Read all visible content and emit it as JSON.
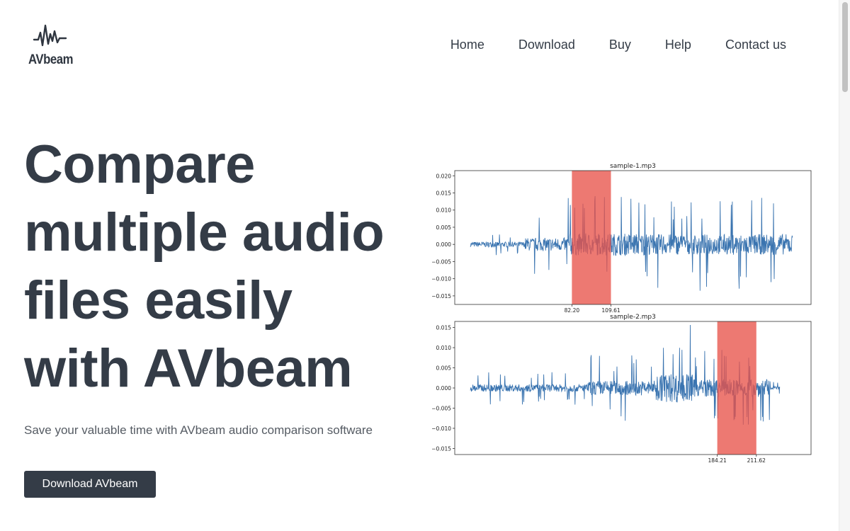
{
  "brand": {
    "name": "AVbeam",
    "logo_icon": "waveform-icon"
  },
  "nav": {
    "items": [
      {
        "label": "Home"
      },
      {
        "label": "Download"
      },
      {
        "label": "Buy"
      },
      {
        "label": "Help"
      },
      {
        "label": "Contact us"
      }
    ]
  },
  "hero": {
    "title_lines": [
      "Compare",
      "multiple audio",
      "files easily",
      "with AVbeam"
    ],
    "subtitle": "Save your valuable time with AVbeam audio comparison software",
    "cta_label": "Download AVbeam"
  },
  "colors": {
    "text_dark": "#343c47",
    "button_bg": "#343c47",
    "waveform": "#3a74b0",
    "highlight": "#e8534a"
  },
  "chart_data": [
    {
      "type": "line",
      "title": "sample-1.mp3",
      "ylim": [
        -0.0175,
        0.0215
      ],
      "yticks": [
        0.02,
        0.015,
        0.01,
        0.005,
        0.0,
        -0.005,
        -0.01,
        -0.015
      ],
      "ytick_labels": [
        "0.020",
        "0.015",
        "0.010",
        "0.005",
        "0.000",
        "−0.005",
        "−0.010",
        "−0.015"
      ],
      "xlim": [
        0,
        250
      ],
      "highlight": {
        "start": 82.2,
        "end": 109.61
      },
      "xtick_labels": [
        "82.20",
        "109.61"
      ],
      "signal_span": [
        11,
        237
      ],
      "grid": false
    },
    {
      "type": "line",
      "title": "sample-2.mp3",
      "ylim": [
        -0.0165,
        0.0165
      ],
      "yticks": [
        0.015,
        0.01,
        0.005,
        0.0,
        -0.005,
        -0.01,
        -0.015
      ],
      "ytick_labels": [
        "0.015",
        "0.010",
        "0.005",
        "0.000",
        "−0.005",
        "−0.010",
        "−0.015"
      ],
      "xlim": [
        0,
        250
      ],
      "highlight": {
        "start": 184.21,
        "end": 211.62
      },
      "xtick_labels": [
        "184.21",
        "211.62"
      ],
      "signal_span": [
        11,
        228
      ],
      "grid": false
    }
  ]
}
